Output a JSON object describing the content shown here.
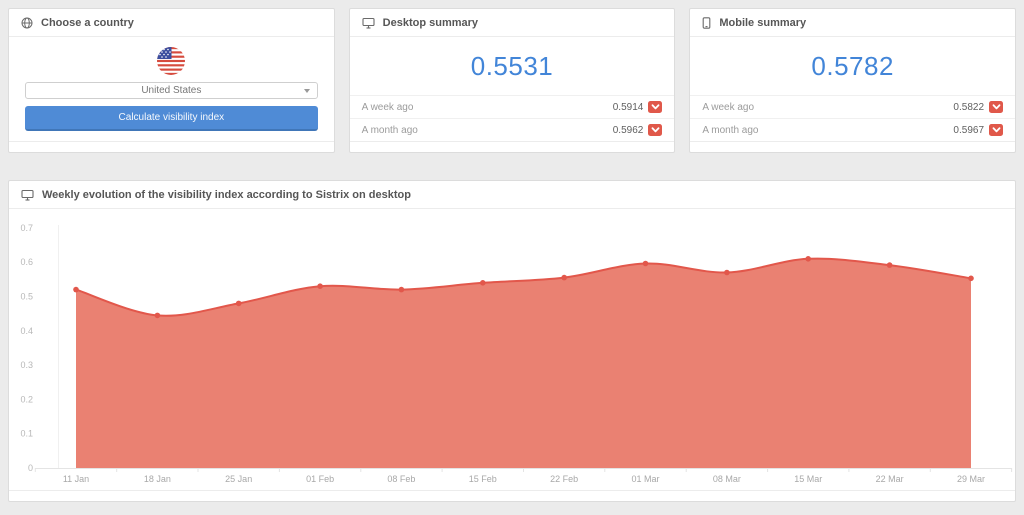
{
  "country_card": {
    "title": "Choose a country",
    "select_value": "United States",
    "button_label": "Calculate visibility index"
  },
  "desktop_card": {
    "title": "Desktop summary",
    "current": "0.5531",
    "rows": [
      {
        "label": "A week ago",
        "value": "0.5914",
        "trend": "down"
      },
      {
        "label": "A month ago",
        "value": "0.5962",
        "trend": "down"
      }
    ]
  },
  "mobile_card": {
    "title": "Mobile summary",
    "current": "0.5782",
    "rows": [
      {
        "label": "A week ago",
        "value": "0.5822",
        "trend": "down"
      },
      {
        "label": "A month ago",
        "value": "0.5967",
        "trend": "down"
      }
    ]
  },
  "chart_card": {
    "title": "Weekly evolution of the visibility index according to Sistrix on desktop"
  },
  "chart_data": {
    "type": "area",
    "title": "Weekly evolution of the visibility index according to Sistrix on desktop",
    "categories": [
      "11 Jan",
      "18 Jan",
      "25 Jan",
      "01 Feb",
      "08 Feb",
      "15 Feb",
      "22 Feb",
      "01 Mar",
      "08 Mar",
      "15 Mar",
      "22 Mar",
      "29 Mar"
    ],
    "values": [
      0.52,
      0.445,
      0.48,
      0.53,
      0.52,
      0.54,
      0.555,
      0.5962,
      0.57,
      0.61,
      0.5914,
      0.5531
    ],
    "xlabel": "",
    "ylabel": "",
    "ylim": [
      0,
      0.7
    ],
    "y_ticks": [
      "0",
      "0.1",
      "0.2",
      "0.3",
      "0.4",
      "0.5",
      "0.6",
      "0.7"
    ],
    "grid": false,
    "legend": "none",
    "colors": {
      "area_fill": "#ea8172",
      "line": "#e2574b",
      "point": "#e2574b"
    }
  },
  "icons": {
    "country": "globe-icon",
    "desktop": "monitor-icon",
    "mobile": "smartphone-icon",
    "chart": "monitor-icon",
    "trend_down": "chevron-down-icon",
    "select": "caret-down-icon",
    "flag": "us-flag-icon"
  },
  "colors": {
    "page_background": "#ebebeb",
    "accent_blue": "#4285d8",
    "button_blue": "#4f8bd6",
    "badge_red": "#e0584a",
    "chart_area": "#ea8172",
    "chart_line": "#e2574b"
  }
}
